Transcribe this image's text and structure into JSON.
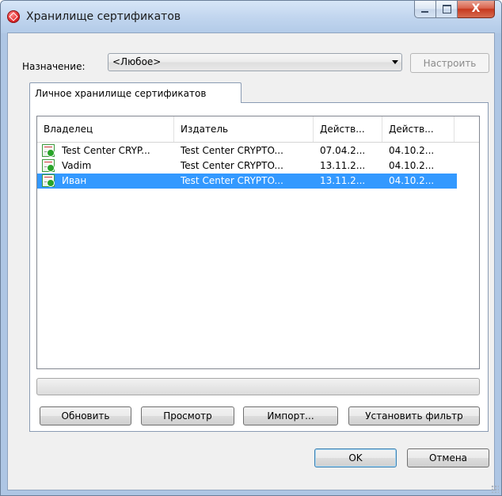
{
  "window": {
    "title": "Хранилище сертификатов",
    "caption_close": "X",
    "colors": {
      "selection": "#3399ff",
      "close_button": "#c6391f",
      "cert_icon": "#28a428"
    }
  },
  "purpose": {
    "label": "Назначение:",
    "selected_value": "<Любое>",
    "configure_button": "Настроить"
  },
  "tabs": [
    {
      "label": "Личное хранилище сертификатов",
      "active": true
    }
  ],
  "certificates": {
    "columns": [
      "Владелец",
      "Издатель",
      "Действ...",
      "Действ..."
    ],
    "rows": [
      {
        "owner": "Test Center CRYP...",
        "issuer": "Test Center CRYPTO...",
        "valid_from": "07.04.2...",
        "valid_to": "04.10.2...",
        "selected": false,
        "icon": "certificate-icon"
      },
      {
        "owner": "Vadim",
        "issuer": "Test Center CRYPTO...",
        "valid_from": "13.11.2...",
        "valid_to": "04.10.2...",
        "selected": false,
        "icon": "certificate-icon"
      },
      {
        "owner": "Иван",
        "issuer": "Test Center CRYPTO...",
        "valid_from": "13.11.2...",
        "valid_to": "04.10.2...",
        "selected": true,
        "icon": "certificate-icon"
      }
    ]
  },
  "actions": {
    "refresh": "Обновить",
    "view": "Просмотр",
    "import": "Импорт...",
    "set_filter": "Установить фильтр"
  },
  "dialog": {
    "ok": "OK",
    "cancel": "Отмена"
  }
}
